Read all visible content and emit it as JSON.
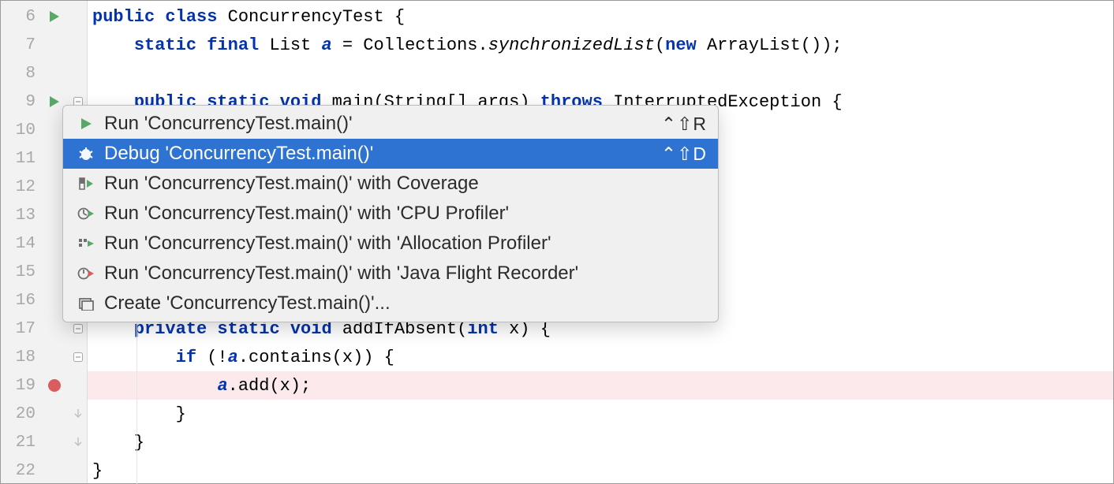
{
  "gutter": {
    "lines": [
      "6",
      "7",
      "8",
      "9",
      "10",
      "11",
      "12",
      "13",
      "14",
      "15",
      "16",
      "17",
      "18",
      "19",
      "20",
      "21",
      "22"
    ],
    "run_arrow_lines": [
      6,
      9
    ],
    "breakpoint_line": 19,
    "fold_minus_lines": [
      9,
      17,
      18
    ],
    "fold_end_lines": [
      20,
      21
    ]
  },
  "code": {
    "l6": {
      "indent": "",
      "t": [
        [
          "kw",
          "public class"
        ],
        [
          "plain",
          " ConcurrencyTest {"
        ]
      ]
    },
    "l7": {
      "indent": "    ",
      "t": [
        [
          "kw",
          "static final"
        ],
        [
          "plain",
          " List "
        ],
        [
          "kw2",
          "a"
        ],
        [
          "plain",
          " = Collections."
        ],
        [
          "ital",
          "synchronizedList"
        ],
        [
          "plain",
          "("
        ],
        [
          "kw",
          "new"
        ],
        [
          "plain",
          " ArrayList());"
        ]
      ]
    },
    "l8": {
      "indent": "",
      "t": []
    },
    "l9": {
      "indent": "    ",
      "t": [
        [
          "kw",
          "public static void"
        ],
        [
          "plain",
          " main(String[] args) "
        ],
        [
          "kw",
          "throws"
        ],
        [
          "plain",
          " InterruptedException {"
        ]
      ]
    },
    "l10": {
      "indent": "",
      "t": []
    },
    "l11": {
      "indent": "",
      "t": []
    },
    "l12": {
      "indent": "",
      "t": []
    },
    "l13": {
      "indent": "",
      "t": []
    },
    "l14": {
      "indent": "",
      "t": []
    },
    "l15": {
      "indent": "",
      "t": []
    },
    "l16": {
      "indent": "",
      "t": []
    },
    "l17": {
      "indent": "    ",
      "t": [
        [
          "kw",
          "private static void"
        ],
        [
          "plain",
          " addIfAbsent("
        ],
        [
          "kw",
          "int"
        ],
        [
          "plain",
          " x) {"
        ]
      ]
    },
    "l18": {
      "indent": "        ",
      "t": [
        [
          "kw",
          "if"
        ],
        [
          "plain",
          " (!"
        ],
        [
          "kw2",
          "a"
        ],
        [
          "plain",
          ".contains(x)) {"
        ]
      ]
    },
    "l19": {
      "indent": "            ",
      "t": [
        [
          "kw2",
          "a"
        ],
        [
          "plain",
          ".add(x);"
        ]
      ]
    },
    "l20": {
      "indent": "        ",
      "t": [
        [
          "plain",
          "}"
        ]
      ]
    },
    "l21": {
      "indent": "    ",
      "t": [
        [
          "plain",
          "}"
        ]
      ]
    },
    "l22": {
      "indent": "",
      "t": [
        [
          "plain",
          "}"
        ]
      ]
    }
  },
  "menu": {
    "items": [
      {
        "icon": "run",
        "label": "Run 'ConcurrencyTest.main()'",
        "shortcut": "⌃⇧R",
        "selected": false
      },
      {
        "icon": "debug",
        "label": "Debug 'ConcurrencyTest.main()'",
        "shortcut": "⌃⇧D",
        "selected": true
      },
      {
        "icon": "coverage",
        "label": "Run 'ConcurrencyTest.main()' with Coverage",
        "shortcut": "",
        "selected": false
      },
      {
        "icon": "profiler",
        "label": "Run 'ConcurrencyTest.main()' with 'CPU Profiler'",
        "shortcut": "",
        "selected": false
      },
      {
        "icon": "alloc",
        "label": "Run 'ConcurrencyTest.main()' with 'Allocation Profiler'",
        "shortcut": "",
        "selected": false
      },
      {
        "icon": "jfr",
        "label": "Run 'ConcurrencyTest.main()' with 'Java Flight Recorder'",
        "shortcut": "",
        "selected": false
      },
      {
        "icon": "create",
        "label": "Create 'ConcurrencyTest.main()'...",
        "shortcut": "",
        "selected": false
      }
    ]
  },
  "colors": {
    "run_green": "#59a869",
    "debug_green": "#6aae5f",
    "breakpoint": "#db5c5c",
    "selection": "#2e72d2"
  }
}
